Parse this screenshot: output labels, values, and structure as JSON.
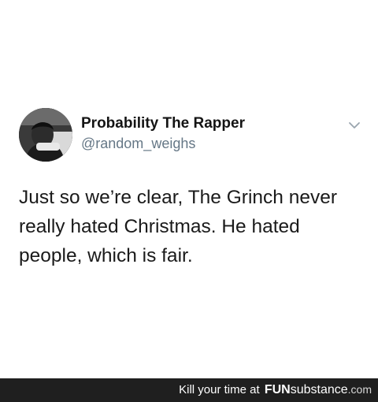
{
  "tweet": {
    "display_name": "Probability The Rapper",
    "handle": "@random_weighs",
    "text": "Just so we’re clear, The Grinch never really hated Christmas. He hated people, which is fair.",
    "menu_icon": "chevron-down-icon",
    "avatar_icon": "avatar"
  },
  "watermark": {
    "prefix": "Kill your time at",
    "brand": "FUN",
    "suffix": "substance",
    "domain": ".com"
  },
  "colors": {
    "background": "#ffffff",
    "text": "#1a1a1a",
    "handle": "#657786",
    "watermark_bar": "#1f1f1f"
  }
}
